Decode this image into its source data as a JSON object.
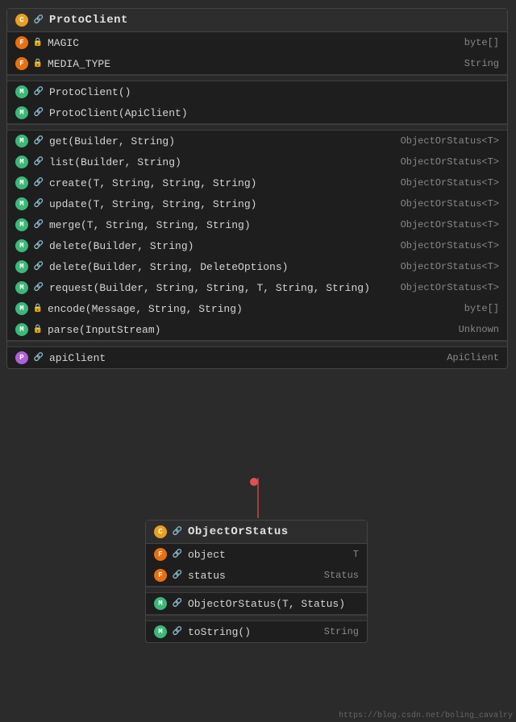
{
  "protoclient": {
    "title": "ProtoClient",
    "header_badge": "C",
    "link_icon": "🔗",
    "fields": [
      {
        "badge": "F",
        "lock": true,
        "name": "MAGIC",
        "type": "byte[]"
      },
      {
        "badge": "F",
        "lock": true,
        "name": "MEDIA_TYPE",
        "type": "String"
      }
    ],
    "constructors": [
      {
        "badge": "M",
        "link": true,
        "name": "ProtoClient()",
        "type": ""
      },
      {
        "badge": "M",
        "link": true,
        "name": "ProtoClient(ApiClient)",
        "type": ""
      }
    ],
    "methods": [
      {
        "badge": "M",
        "link": true,
        "name": "get(Builder, String)",
        "type": "ObjectOrStatus<T>"
      },
      {
        "badge": "M",
        "link": true,
        "name": "list(Builder, String)",
        "type": "ObjectOrStatus<T>"
      },
      {
        "badge": "M",
        "link": true,
        "name": "create(T, String, String, String)",
        "type": "ObjectOrStatus<T>"
      },
      {
        "badge": "M",
        "link": true,
        "name": "update(T, String, String, String)",
        "type": "ObjectOrStatus<T>"
      },
      {
        "badge": "M",
        "link": true,
        "name": "merge(T, String, String, String)",
        "type": "ObjectOrStatus<T>"
      },
      {
        "badge": "M",
        "link": true,
        "name": "delete(Builder, String)",
        "type": "ObjectOrStatus<T>"
      },
      {
        "badge": "M",
        "link": true,
        "name": "delete(Builder, String, DeleteOptions)",
        "type": "ObjectOrStatus<T>"
      },
      {
        "badge": "M",
        "link": true,
        "name": "request(Builder, String, String, T, String, String)",
        "type": "ObjectOrStatus<T>"
      },
      {
        "badge": "M",
        "lock": true,
        "name": "encode(Message, String, String)",
        "type": "byte[]"
      },
      {
        "badge": "M",
        "lock": true,
        "name": "parse(InputStream)",
        "type": "Unknown"
      }
    ],
    "properties": [
      {
        "badge": "P",
        "link": true,
        "name": "apiClient",
        "type": "ApiClient"
      }
    ]
  },
  "objectorstatus": {
    "title": "ObjectOrStatus",
    "header_badge": "C",
    "link_icon": "🔗",
    "fields": [
      {
        "badge": "F",
        "link": true,
        "name": "object",
        "type": "T"
      },
      {
        "badge": "F",
        "link": true,
        "name": "status",
        "type": "Status"
      }
    ],
    "constructors": [
      {
        "badge": "M",
        "link": true,
        "name": "ObjectOrStatus(T, Status)",
        "type": ""
      }
    ],
    "methods": [
      {
        "badge": "M",
        "link": true,
        "name": "toString()",
        "type": "String"
      }
    ]
  },
  "watermark": "https://blog.csdn.net/boling_cavalry"
}
